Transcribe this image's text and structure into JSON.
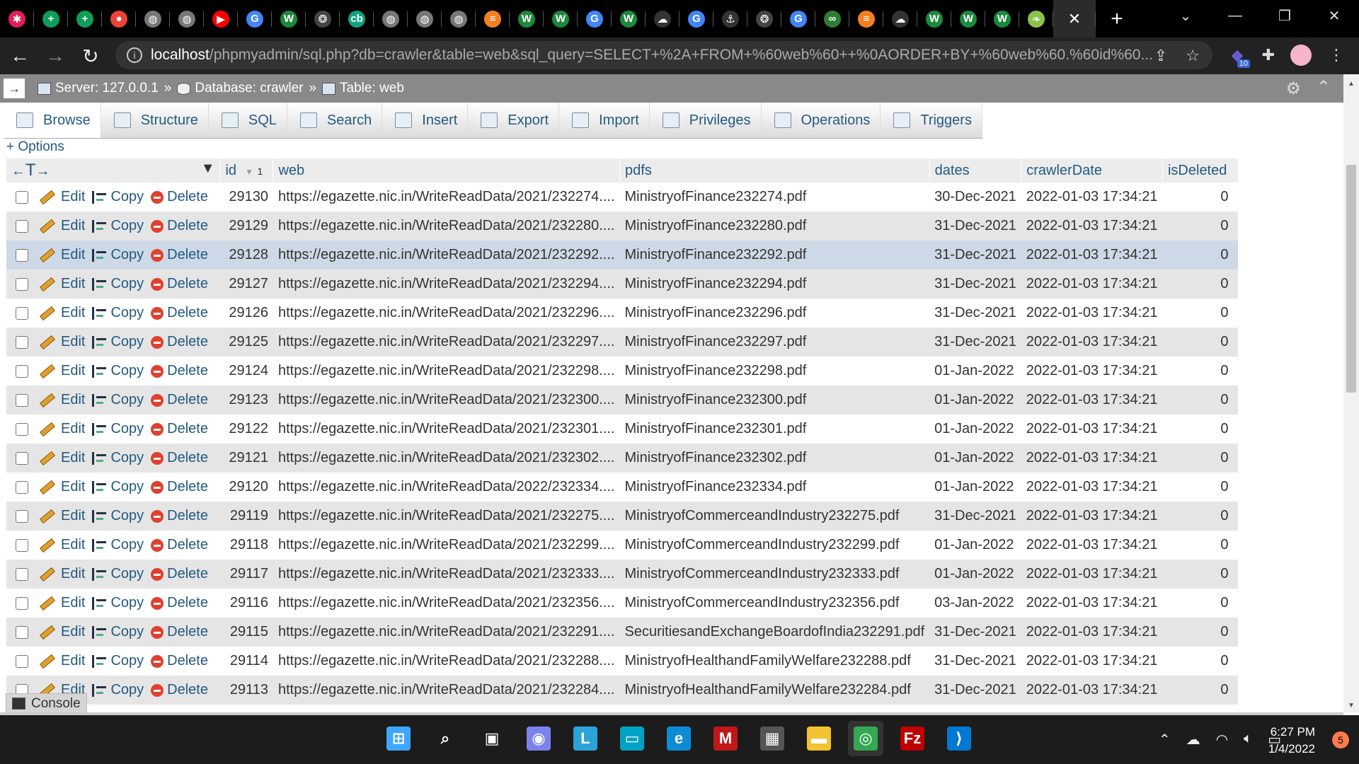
{
  "browser": {
    "tabs": [
      {
        "icon": "slack-icon",
        "glyph": "✱",
        "color": "#e01e5a"
      },
      {
        "icon": "sheets-icon",
        "glyph": "+",
        "color": "#0f9d58"
      },
      {
        "icon": "sheets-icon",
        "glyph": "+",
        "color": "#0f9d58"
      },
      {
        "icon": "maps-pin-icon",
        "glyph": "●",
        "color": "#ea4335"
      },
      {
        "icon": "globe-icon",
        "glyph": "◍",
        "color": "#777777"
      },
      {
        "icon": "globe-icon",
        "glyph": "◍",
        "color": "#777777"
      },
      {
        "icon": "youtube-icon",
        "glyph": "▶",
        "color": "#ff0000"
      },
      {
        "icon": "google-icon",
        "glyph": "G",
        "color": "#4285f4"
      },
      {
        "icon": "wix-icon",
        "glyph": "W",
        "color": "#1b8a3a"
      },
      {
        "icon": "openai-icon",
        "glyph": "❂",
        "color": "#444444"
      },
      {
        "icon": "chatbot-icon",
        "glyph": "cb",
        "color": "#10a37f"
      },
      {
        "icon": "globe-icon",
        "glyph": "◍",
        "color": "#777777"
      },
      {
        "icon": "globe-icon",
        "glyph": "◍",
        "color": "#777777"
      },
      {
        "icon": "globe-icon",
        "glyph": "◍",
        "color": "#777777"
      },
      {
        "icon": "stackoverflow-icon",
        "glyph": "≡",
        "color": "#f48024"
      },
      {
        "icon": "wix-icon",
        "glyph": "W",
        "color": "#1b8a3a"
      },
      {
        "icon": "wix-icon",
        "glyph": "W",
        "color": "#1b8a3a"
      },
      {
        "icon": "google-icon",
        "glyph": "G",
        "color": "#4285f4"
      },
      {
        "icon": "wix-icon",
        "glyph": "W",
        "color": "#1b8a3a"
      },
      {
        "icon": "cloud-icon",
        "glyph": "☁",
        "color": "#333333"
      },
      {
        "icon": "google-icon",
        "glyph": "G",
        "color": "#4285f4"
      },
      {
        "icon": "anchor-icon",
        "glyph": "⚓",
        "color": "#333333"
      },
      {
        "icon": "openai-icon",
        "glyph": "❂",
        "color": "#444444"
      },
      {
        "icon": "google-icon",
        "glyph": "G",
        "color": "#4285f4"
      },
      {
        "icon": "link-icon",
        "glyph": "∞",
        "color": "#2e7d32"
      },
      {
        "icon": "stackoverflow-icon",
        "glyph": "≡",
        "color": "#f48024"
      },
      {
        "icon": "cloud-icon",
        "glyph": "☁",
        "color": "#333333"
      },
      {
        "icon": "wix-icon",
        "glyph": "W",
        "color": "#1b8a3a"
      },
      {
        "icon": "wix-icon",
        "glyph": "W",
        "color": "#1b8a3a"
      },
      {
        "icon": "wix-icon",
        "glyph": "W",
        "color": "#1b8a3a"
      },
      {
        "icon": "leaf-icon",
        "glyph": "❧",
        "color": "#8bc34a"
      }
    ],
    "url_host": "localhost",
    "url_path": "/phpmyadmin/sql.php?db=crawler&table=web&sql_query=SELECT+%2A+FROM+%60web%60++%0AORDER+BY+%60web%60.%60id%60...",
    "extension_badge": "10"
  },
  "pma": {
    "breadcrumb": {
      "server": "Server: 127.0.0.1",
      "database": "Database: crawler",
      "table": "Table: web",
      "sep": "»"
    },
    "tabs": [
      "Browse",
      "Structure",
      "SQL",
      "Search",
      "Insert",
      "Export",
      "Import",
      "Privileges",
      "Operations",
      "Triggers"
    ],
    "options_label": "+ Options",
    "sort_order": "1",
    "columns": [
      "id",
      "web",
      "pdfs",
      "dates",
      "crawlerDate",
      "isDeleted"
    ],
    "actions": {
      "edit": "Edit",
      "copy": "Copy",
      "delete": "Delete"
    },
    "rows": [
      {
        "id": "29130",
        "web": "https://egazette.nic.in/WriteReadData/2021/232274....",
        "pdfs": "MinistryofFinance232274.pdf",
        "dates": "30-Dec-2021",
        "crawlerDate": "2022-01-03 17:34:21",
        "isDeleted": "0"
      },
      {
        "id": "29129",
        "web": "https://egazette.nic.in/WriteReadData/2021/232280....",
        "pdfs": "MinistryofFinance232280.pdf",
        "dates": "31-Dec-2021",
        "crawlerDate": "2022-01-03 17:34:21",
        "isDeleted": "0"
      },
      {
        "id": "29128",
        "web": "https://egazette.nic.in/WriteReadData/2021/232292....",
        "pdfs": "MinistryofFinance232292.pdf",
        "dates": "31-Dec-2021",
        "crawlerDate": "2022-01-03 17:34:21",
        "isDeleted": "0"
      },
      {
        "id": "29127",
        "web": "https://egazette.nic.in/WriteReadData/2021/232294....",
        "pdfs": "MinistryofFinance232294.pdf",
        "dates": "31-Dec-2021",
        "crawlerDate": "2022-01-03 17:34:21",
        "isDeleted": "0"
      },
      {
        "id": "29126",
        "web": "https://egazette.nic.in/WriteReadData/2021/232296....",
        "pdfs": "MinistryofFinance232296.pdf",
        "dates": "31-Dec-2021",
        "crawlerDate": "2022-01-03 17:34:21",
        "isDeleted": "0"
      },
      {
        "id": "29125",
        "web": "https://egazette.nic.in/WriteReadData/2021/232297....",
        "pdfs": "MinistryofFinance232297.pdf",
        "dates": "31-Dec-2021",
        "crawlerDate": "2022-01-03 17:34:21",
        "isDeleted": "0"
      },
      {
        "id": "29124",
        "web": "https://egazette.nic.in/WriteReadData/2021/232298....",
        "pdfs": "MinistryofFinance232298.pdf",
        "dates": "01-Jan-2022",
        "crawlerDate": "2022-01-03 17:34:21",
        "isDeleted": "0"
      },
      {
        "id": "29123",
        "web": "https://egazette.nic.in/WriteReadData/2021/232300....",
        "pdfs": "MinistryofFinance232300.pdf",
        "dates": "01-Jan-2022",
        "crawlerDate": "2022-01-03 17:34:21",
        "isDeleted": "0"
      },
      {
        "id": "29122",
        "web": "https://egazette.nic.in/WriteReadData/2021/232301....",
        "pdfs": "MinistryofFinance232301.pdf",
        "dates": "01-Jan-2022",
        "crawlerDate": "2022-01-03 17:34:21",
        "isDeleted": "0"
      },
      {
        "id": "29121",
        "web": "https://egazette.nic.in/WriteReadData/2021/232302....",
        "pdfs": "MinistryofFinance232302.pdf",
        "dates": "01-Jan-2022",
        "crawlerDate": "2022-01-03 17:34:21",
        "isDeleted": "0"
      },
      {
        "id": "29120",
        "web": "https://egazette.nic.in/WriteReadData/2022/232334....",
        "pdfs": "MinistryofFinance232334.pdf",
        "dates": "01-Jan-2022",
        "crawlerDate": "2022-01-03 17:34:21",
        "isDeleted": "0"
      },
      {
        "id": "29119",
        "web": "https://egazette.nic.in/WriteReadData/2021/232275....",
        "pdfs": "MinistryofCommerceandIndustry232275.pdf",
        "dates": "31-Dec-2021",
        "crawlerDate": "2022-01-03 17:34:21",
        "isDeleted": "0"
      },
      {
        "id": "29118",
        "web": "https://egazette.nic.in/WriteReadData/2021/232299....",
        "pdfs": "MinistryofCommerceandIndustry232299.pdf",
        "dates": "01-Jan-2022",
        "crawlerDate": "2022-01-03 17:34:21",
        "isDeleted": "0"
      },
      {
        "id": "29117",
        "web": "https://egazette.nic.in/WriteReadData/2021/232333....",
        "pdfs": "MinistryofCommerceandIndustry232333.pdf",
        "dates": "01-Jan-2022",
        "crawlerDate": "2022-01-03 17:34:21",
        "isDeleted": "0"
      },
      {
        "id": "29116",
        "web": "https://egazette.nic.in/WriteReadData/2021/232356....",
        "pdfs": "MinistryofCommerceandIndustry232356.pdf",
        "dates": "03-Jan-2022",
        "crawlerDate": "2022-01-03 17:34:21",
        "isDeleted": "0"
      },
      {
        "id": "29115",
        "web": "https://egazette.nic.in/WriteReadData/2021/232291....",
        "pdfs": "SecuritiesandExchangeBoardofIndia232291.pdf",
        "dates": "31-Dec-2021",
        "crawlerDate": "2022-01-03 17:34:21",
        "isDeleted": "0"
      },
      {
        "id": "29114",
        "web": "https://egazette.nic.in/WriteReadData/2021/232288....",
        "pdfs": "MinistryofHealthandFamilyWelfare232288.pdf",
        "dates": "31-Dec-2021",
        "crawlerDate": "2022-01-03 17:34:21",
        "isDeleted": "0"
      },
      {
        "id": "29113",
        "web": "https://egazette.nic.in/WriteReadData/2021/232284....",
        "pdfs": "MinistryofHealthandFamilyWelfare232284.pdf",
        "dates": "31-Dec-2021",
        "crawlerDate": "2022-01-03 17:34:21",
        "isDeleted": "0"
      }
    ],
    "highlighted_row_id": "29128",
    "console_label": "Console"
  },
  "taskbar": {
    "apps": [
      {
        "icon": "windows-start-icon",
        "glyph": "⊞",
        "color": "#3ea6ff"
      },
      {
        "icon": "search-icon",
        "glyph": "⌕",
        "color": "#1c1c1c"
      },
      {
        "icon": "task-view-icon",
        "glyph": "▣",
        "color": "#1c1c1c"
      },
      {
        "icon": "teams-chat-icon",
        "glyph": "◉",
        "color": "#7b83eb"
      },
      {
        "icon": "l-app-icon",
        "glyph": "L",
        "color": "#2aa3d8"
      },
      {
        "icon": "monitor-icon",
        "glyph": "▭",
        "color": "#00a3c4"
      },
      {
        "icon": "edge-icon",
        "glyph": "e",
        "color": "#0c8bd6"
      },
      {
        "icon": "mcafee-icon",
        "glyph": "M",
        "color": "#c01818"
      },
      {
        "icon": "store-icon",
        "glyph": "▦",
        "color": "#555555"
      },
      {
        "icon": "file-explorer-icon",
        "glyph": "▬",
        "color": "#f2c230"
      },
      {
        "icon": "chrome-icon",
        "glyph": "◎",
        "color": "#34a853"
      },
      {
        "icon": "filezilla-icon",
        "glyph": "Fz",
        "color": "#bf0000"
      },
      {
        "icon": "vscode-icon",
        "glyph": "⟩",
        "color": "#0078d4"
      }
    ],
    "time": "6:27 PM",
    "date": "1/4/2022",
    "notifications": "5"
  }
}
